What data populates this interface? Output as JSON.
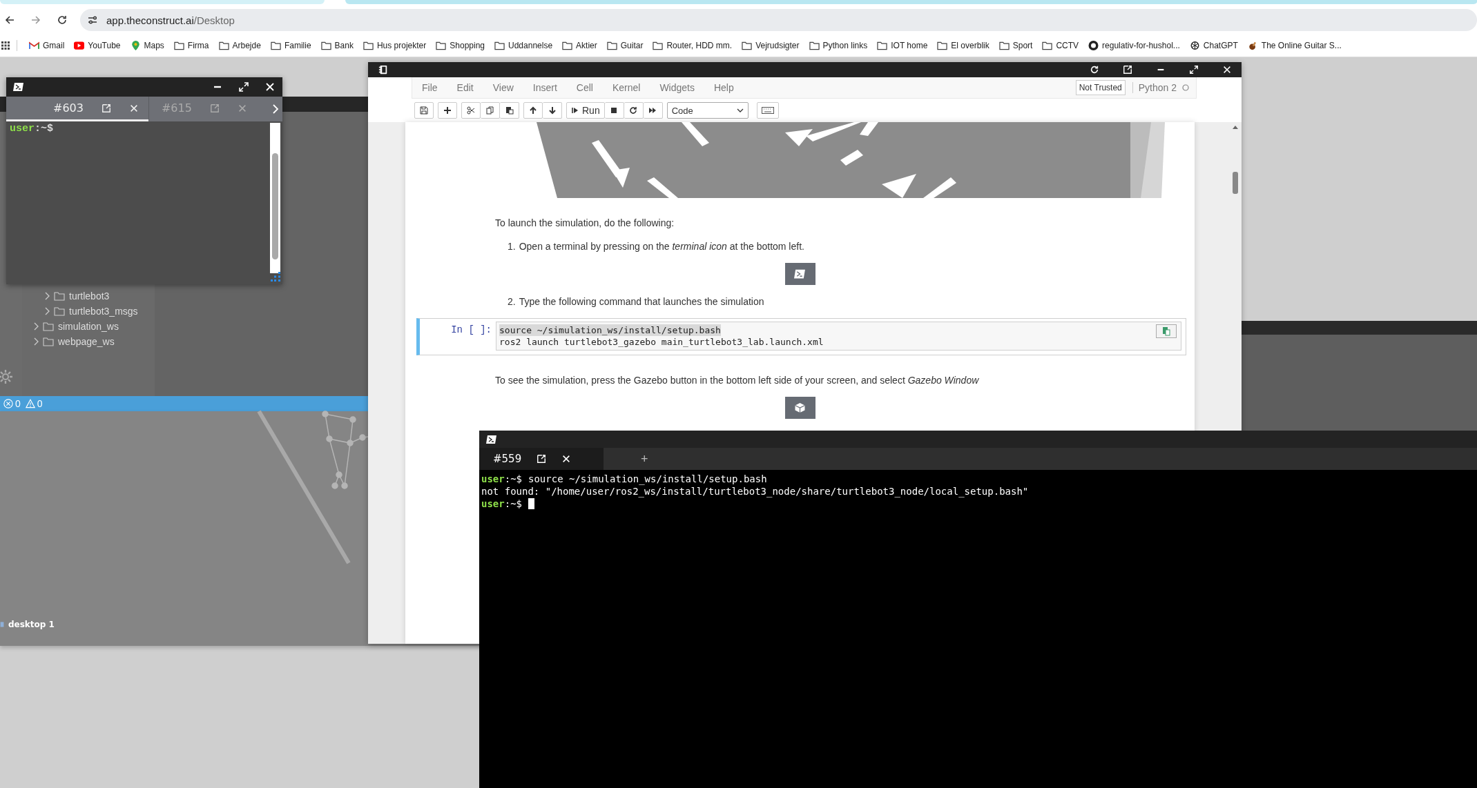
{
  "browser": {
    "address": {
      "host": "app.theconstruct.ai",
      "path": "/Desktop"
    },
    "bookmarks": [
      {
        "label": "Gmail",
        "kind": "gmail"
      },
      {
        "label": "YouTube",
        "kind": "youtube"
      },
      {
        "label": "Maps",
        "kind": "maps"
      },
      {
        "label": "Firma",
        "kind": "folder"
      },
      {
        "label": "Arbejde",
        "kind": "folder"
      },
      {
        "label": "Familie",
        "kind": "folder"
      },
      {
        "label": "Bank",
        "kind": "folder"
      },
      {
        "label": "Hus projekter",
        "kind": "folder"
      },
      {
        "label": "Shopping",
        "kind": "folder"
      },
      {
        "label": "Uddannelse",
        "kind": "folder"
      },
      {
        "label": "Aktier",
        "kind": "folder"
      },
      {
        "label": "Guitar",
        "kind": "folder"
      },
      {
        "label": "Router, HDD mm.",
        "kind": "folder"
      },
      {
        "label": "Vejrudsigter",
        "kind": "folder"
      },
      {
        "label": "Python links",
        "kind": "folder"
      },
      {
        "label": "IOT home",
        "kind": "folder"
      },
      {
        "label": "El overblik",
        "kind": "folder"
      },
      {
        "label": "Sport",
        "kind": "folder"
      },
      {
        "label": "CCTV",
        "kind": "folder"
      },
      {
        "label": "regulativ-for-hushol...",
        "kind": "github"
      },
      {
        "label": "ChatGPT",
        "kind": "chatgpt"
      },
      {
        "label": "The Online Guitar S...",
        "kind": "guitar"
      }
    ]
  },
  "ide": {
    "tree": [
      {
        "children": [
          {
            "label": "turtlebot3"
          },
          {
            "label": "turtlebot3_msgs"
          }
        ]
      },
      {
        "label": "simulation_ws"
      },
      {
        "label": "webpage_ws"
      }
    ],
    "status_bar": {
      "errors": "0",
      "warnings": "0"
    }
  },
  "desktop": {
    "label": "desktop 1"
  },
  "small_terminal": {
    "tabs": [
      {
        "label": "#603",
        "selected": true
      },
      {
        "label": "#615",
        "selected": false
      }
    ],
    "prompt": {
      "user": "user",
      "path": ":~$"
    }
  },
  "notebook": {
    "menu": [
      "File",
      "Edit",
      "View",
      "Insert",
      "Cell",
      "Kernel",
      "Widgets",
      "Help"
    ],
    "trust": "Not Trusted",
    "kernel": "Python 2",
    "run": "Run",
    "cell_type": "Code",
    "cells": [
      {
        "kind": "picture"
      },
      {
        "kind": "text",
        "text": "To launch the simulation, do the following:"
      },
      {
        "kind": "step",
        "number": "1.",
        "text": "Open a terminal by pressing on the *terminal icon* at the bottom left."
      },
      {
        "kind": "terminal_button"
      },
      {
        "kind": "step",
        "number": "2.",
        "text": "Type the following command that launches the simulation"
      },
      {
        "kind": "code",
        "prompt": "In [ ]:",
        "lines": [
          "source ~/simulation_ws/install/setup.bash",
          "ros2 launch turtlebot3_gazebo main_turtlebot3_lab.launch.xml"
        ]
      },
      {
        "kind": "text",
        "text": "To see the simulation, press the Gazebo button in the bottom left side of your screen, and select *Gazebo Window*"
      },
      {
        "kind": "gazebo_button"
      }
    ]
  },
  "terminal": {
    "tabs": [
      {
        "label": "#559",
        "selected": true
      }
    ],
    "add": "+",
    "lines": [
      {
        "kind": "prompt",
        "user": "user",
        "path": ":~$",
        "text": "source ~/simulation_ws/install/setup.bash",
        "cursor": false
      },
      {
        "kind": "output",
        "text": "not found: \"/home/user/ros2_ws/install/turtlebot3_node/share/turtlebot3_node/local_setup.bash\"",
        "cursor": false
      },
      {
        "kind": "prompt",
        "user": "user",
        "path": ":~$",
        "cursor": true
      }
    ]
  }
}
